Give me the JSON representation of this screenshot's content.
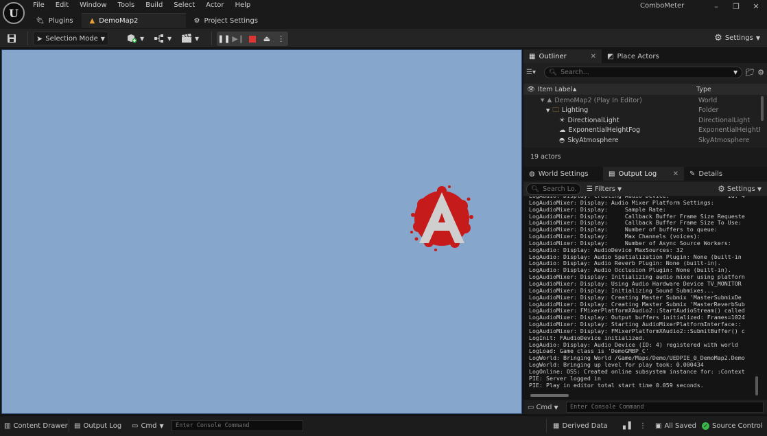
{
  "app": {
    "logo_letter": "U",
    "title": "ComboMeter",
    "menu": [
      "File",
      "Edit",
      "Window",
      "Tools",
      "Build",
      "Select",
      "Actor",
      "Help"
    ],
    "window_controls": {
      "minimize": "–",
      "maximize": "❐",
      "close": "✕"
    },
    "tabs": [
      {
        "label": "Plugins",
        "icon": "plug-icon",
        "active": false
      },
      {
        "label": "DemoMap2",
        "icon": "level-icon",
        "active": true
      },
      {
        "label": "Project Settings",
        "icon": "gear-icon",
        "active": false
      }
    ]
  },
  "toolbar": {
    "selection_mode": "Selection Mode",
    "settings": "Settings"
  },
  "colors": {
    "viewport_sky": "#86a6cc",
    "logo_red": "#c61b1b",
    "stop_red": "#e03232",
    "accent_orange": "#e9a035",
    "source_control_green": "#3ab54a"
  },
  "outliner": {
    "tab_label": "Outliner",
    "place_actors_label": "Place Actors",
    "search_placeholder": "Search...",
    "col_item_label": "Item Label",
    "col_type": "Type",
    "rows": [
      {
        "label": "DemoMap2 (Play In Editor)",
        "type": "World",
        "depth": 0,
        "icon": "level-icon",
        "dim": true
      },
      {
        "label": "Lighting",
        "type": "Folder",
        "depth": 1,
        "icon": "folder-icon",
        "dim": false
      },
      {
        "label": "DirectionalLight",
        "type": "DirectionalLight",
        "depth": 2,
        "icon": "sun-icon",
        "dim": false
      },
      {
        "label": "ExponentialHeightFog",
        "type": "ExponentialHeightF",
        "depth": 2,
        "icon": "fog-icon",
        "dim": false
      },
      {
        "label": "SkyAtmosphere",
        "type": "SkyAtmosphere",
        "depth": 2,
        "icon": "atmosphere-icon",
        "dim": false
      }
    ],
    "actor_count": "19 actors"
  },
  "lower_tabs": {
    "world_settings": "World Settings",
    "output_log": "Output Log",
    "details": "Details"
  },
  "output_log": {
    "search_placeholder": "Search Lo...",
    "filters": "Filters",
    "settings": "Settings",
    "lines": [
      "LogAudio: Display: Creating Audio Device:                 Id: 4",
      "LogAudioMixer: Display: Audio Mixer Platform Settings:",
      "LogAudioMixer: Display:     Sample Rate:",
      "LogAudioMixer: Display:     Callback Buffer Frame Size Requeste",
      "LogAudioMixer: Display:     Callback Buffer Frame Size To Use:",
      "LogAudioMixer: Display:     Number of buffers to queue:",
      "LogAudioMixer: Display:     Max Channels (voices):",
      "LogAudioMixer: Display:     Number of Async Source Workers:",
      "LogAudio: Display: AudioDevice MaxSources: 32",
      "LogAudio: Display: Audio Spatialization Plugin: None (built-in",
      "LogAudio: Display: Audio Reverb Plugin: None (built-in).",
      "LogAudio: Display: Audio Occlusion Plugin: None (built-in).",
      "LogAudioMixer: Display: Initializing audio mixer using platforn",
      "LogAudioMixer: Display: Using Audio Hardware Device TV_MONITOR",
      "LogAudioMixer: Display: Initializing Sound Submixes...",
      "LogAudioMixer: Display: Creating Master Submix 'MasterSubmixDe",
      "LogAudioMixer: Display: Creating Master Submix 'MasterReverbSub",
      "LogAudioMixer: FMixerPlatformXAudio2::StartAudioStream() called",
      "LogAudioMixer: Display: Output buffers initialized: Frames=1024",
      "LogAudioMixer: Display: Starting AudioMixerPlatformInterface::",
      "LogAudioMixer: Display: FMixerPlatformXAudio2::SubmitBuffer() c",
      "LogInit: FAudioDevice initialized.",
      "LogAudio: Display: Audio Device (ID: 4) registered with world",
      "LogLoad: Game class is 'DemoGMBP_C'",
      "LogWorld: Bringing World /Game/Maps/Demo/UEDPIE_0_DemoMap2.Demo",
      "LogWorld: Bringing up level for play took: 0.000434",
      "LogOnline: OSS: Created online subsystem instance for: :Context",
      "PIE: Server logged in",
      "PIE: Play in editor total start time 0.059 seconds."
    ],
    "cmd_label": "Cmd",
    "console_placeholder": "Enter Console Command"
  },
  "statusbar": {
    "content_drawer": "Content Drawer",
    "output_log": "Output Log",
    "cmd": "Cmd",
    "console_placeholder": "Enter Console Command",
    "derived_data": "Derived Data",
    "all_saved": "All Saved",
    "source_control": "Source Control"
  }
}
